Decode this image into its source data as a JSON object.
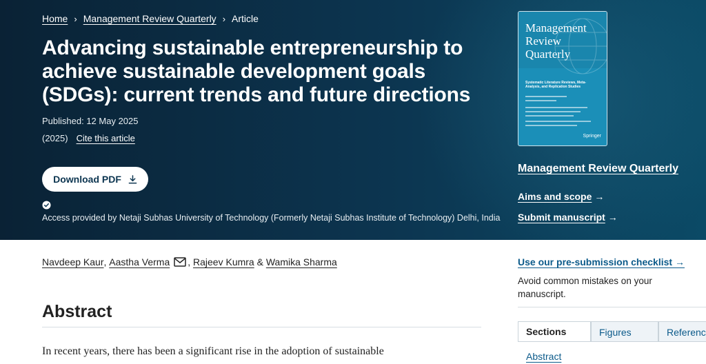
{
  "breadcrumb": {
    "home": "Home",
    "journal": "Management Review Quarterly",
    "current": "Article",
    "separator": "›"
  },
  "article": {
    "title": "Advancing sustainable entrepreneurship to achieve sustainable development goals (SDGs): current trends and future directions",
    "published": "Published: 12 May 2025",
    "year": "(2025)",
    "cite_label": "Cite this article",
    "download_label": "Download PDF",
    "access_text": "Access provided by Netaji Subhas University of Technology (Formerly Netaji Subhas Institute of Technology) Delhi, India"
  },
  "authors": {
    "a1": "Navdeep Kaur",
    "a2": "Aastha Verma",
    "a3": "Rajeev Kumra",
    "a4": "Wamika Sharma",
    "comma": ",",
    "amp": "&"
  },
  "abstract": {
    "heading": "Abstract",
    "text": "In recent years, there has been a significant rise in the adoption of sustainable entrepreneurship, which is recognized as a critical component in achieving the United"
  },
  "cover": {
    "title_line1": "Management",
    "title_line2": "Review",
    "title_line3": "Quarterly",
    "subtitle": "Systematic Literature Reviews, Meta-Analysis, and Replication Studies",
    "publisher": "Springer"
  },
  "sidebar": {
    "journal_title": "Management Review Quarterly",
    "aims_label": "Aims and scope",
    "submit_label": "Submit manuscript",
    "arrow": "→",
    "checklist_label": "Use our pre-submission checklist →",
    "checklist_desc": "Avoid common mistakes on your manuscript.",
    "tabs": [
      "Sections",
      "Figures",
      "References"
    ],
    "toc_first": "Abstract"
  },
  "colors": {
    "hero_dark": "#0a2235",
    "hero_mid": "#0c3550",
    "link_blue": "#0b5a8a",
    "cover_blue": "#1b8fb8"
  }
}
